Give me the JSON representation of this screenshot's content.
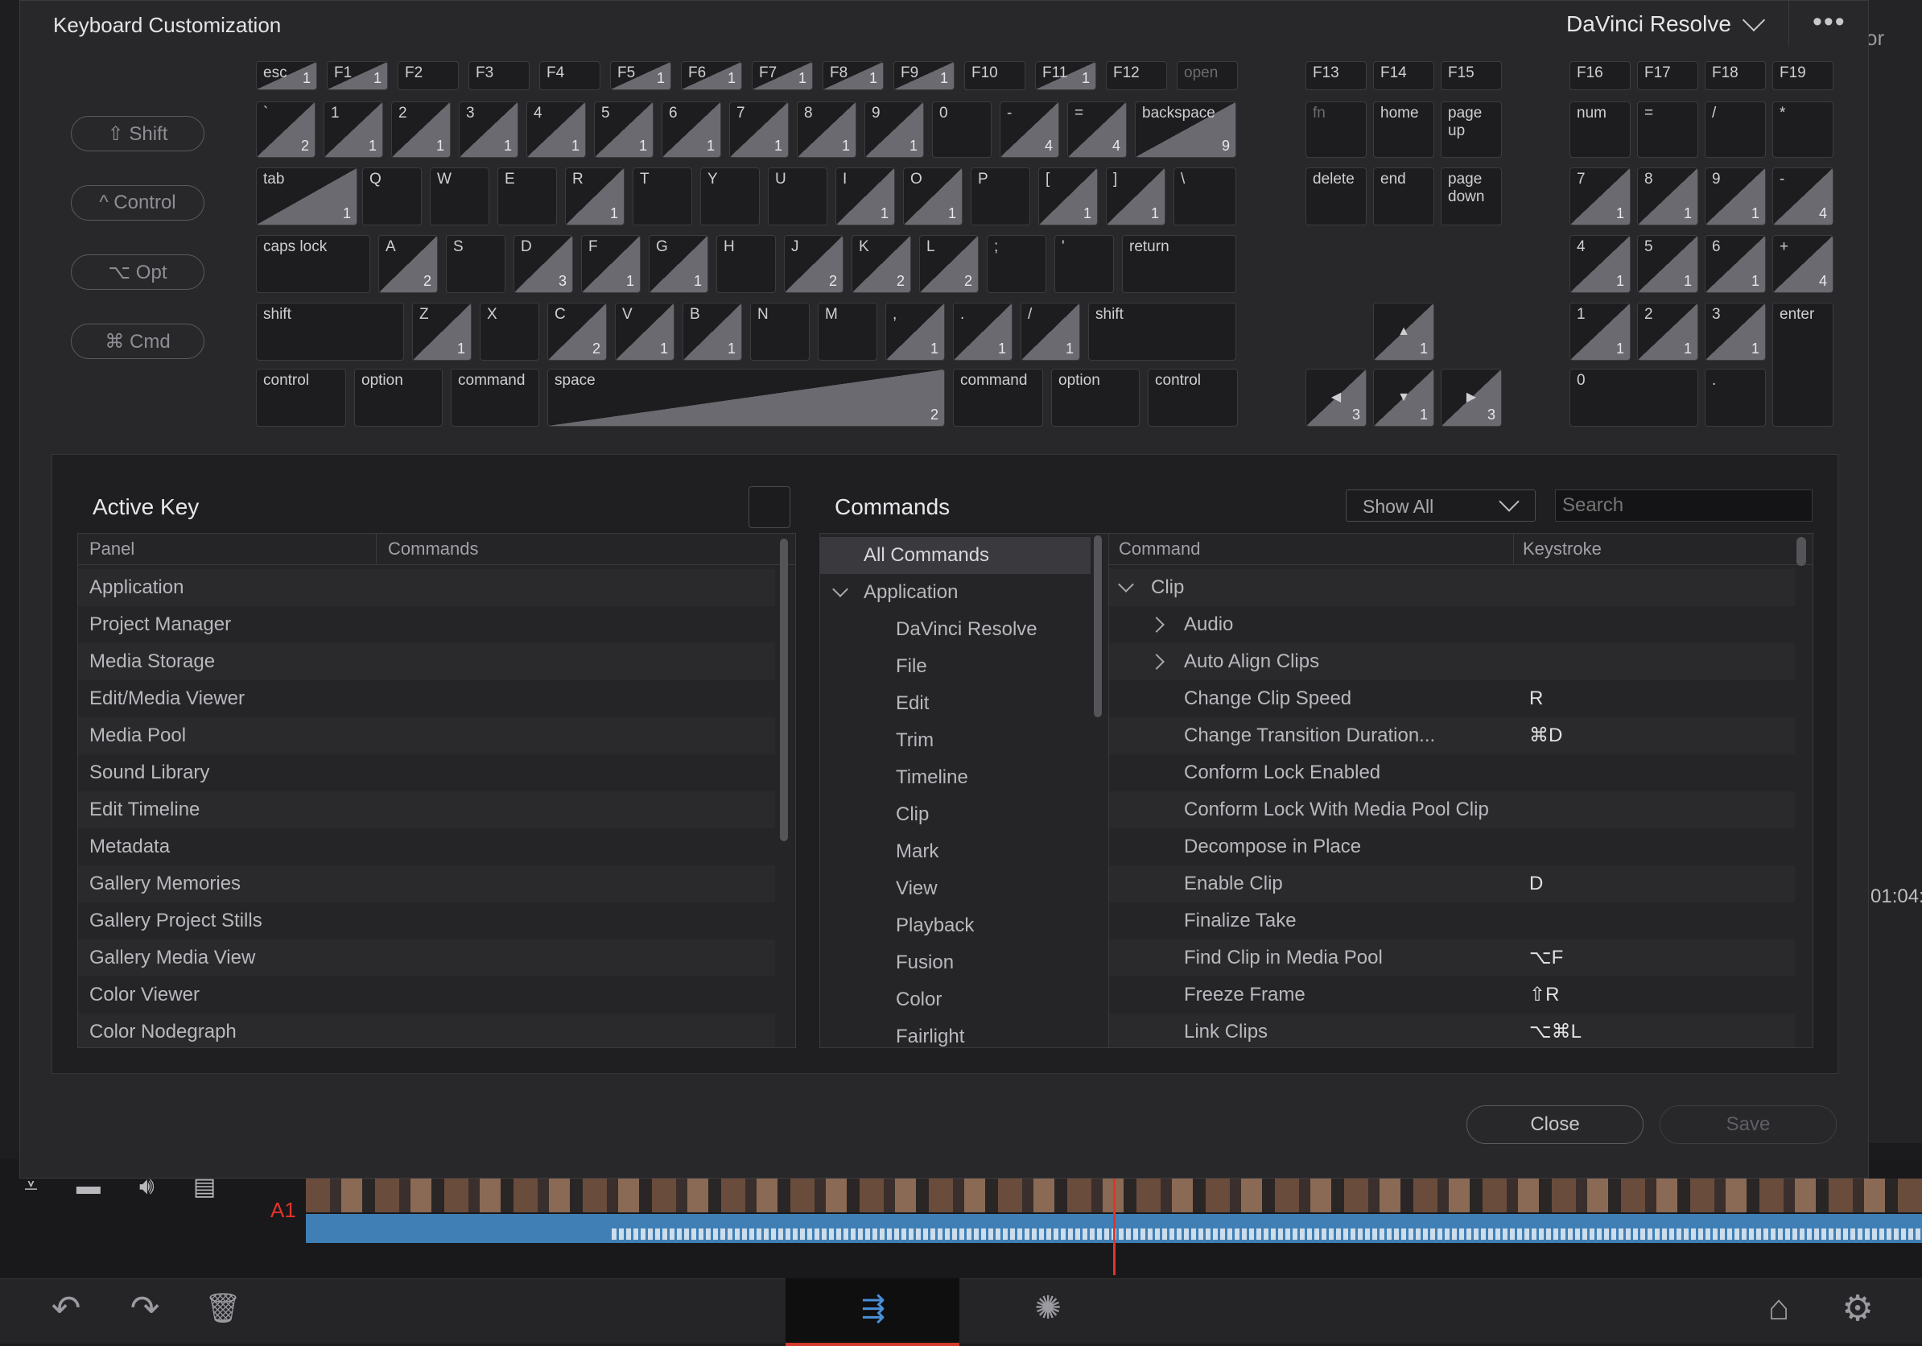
{
  "background_app": {
    "right_edge_text": "or",
    "timecode": "01:04:",
    "track_label": "A1",
    "accent_color": "#e0342b"
  },
  "dialog": {
    "title": "Keyboard Customization",
    "preset": "DaVinci Resolve",
    "more_icon": "ellipsis-icon"
  },
  "modifiers": [
    "⇧ Shift",
    "^ Control",
    "⌥ Opt",
    "⌘ Cmd"
  ],
  "keyboard": {
    "rows": [
      [
        {
          "l": "esc",
          "c": "1"
        },
        {
          "l": "F1",
          "c": "1"
        },
        {
          "l": "F2"
        },
        {
          "l": "F3"
        },
        {
          "l": "F4"
        },
        {
          "l": "F5",
          "c": "1"
        },
        {
          "l": "F6",
          "c": "1"
        },
        {
          "l": "F7",
          "c": "1"
        },
        {
          "l": "F8",
          "c": "1"
        },
        {
          "l": "F9",
          "c": "1"
        },
        {
          "l": "F10"
        },
        {
          "l": "F11",
          "c": "1"
        },
        {
          "l": "F12"
        },
        {
          "l": "open",
          "dim": true
        }
      ],
      [
        {
          "l": "`",
          "c": "2"
        },
        {
          "l": "1",
          "c": "1"
        },
        {
          "l": "2",
          "c": "1"
        },
        {
          "l": "3",
          "c": "1"
        },
        {
          "l": "4",
          "c": "1"
        },
        {
          "l": "5",
          "c": "1"
        },
        {
          "l": "6",
          "c": "1"
        },
        {
          "l": "7",
          "c": "1"
        },
        {
          "l": "8",
          "c": "1"
        },
        {
          "l": "9",
          "c": "1"
        },
        {
          "l": "0"
        },
        {
          "l": "-",
          "c": "4"
        },
        {
          "l": "=",
          "c": "4"
        },
        {
          "l": "backspace",
          "c": "9"
        }
      ],
      [
        {
          "l": "tab",
          "c": "1"
        },
        {
          "l": "Q"
        },
        {
          "l": "W"
        },
        {
          "l": "E"
        },
        {
          "l": "R",
          "c": "1"
        },
        {
          "l": "T"
        },
        {
          "l": "Y"
        },
        {
          "l": "U"
        },
        {
          "l": "I",
          "c": "1"
        },
        {
          "l": "O",
          "c": "1"
        },
        {
          "l": "P"
        },
        {
          "l": "[",
          "c": "1"
        },
        {
          "l": "]",
          "c": "1"
        },
        {
          "l": "\\"
        }
      ],
      [
        {
          "l": "caps lock"
        },
        {
          "l": "A",
          "c": "2"
        },
        {
          "l": "S"
        },
        {
          "l": "D",
          "c": "3"
        },
        {
          "l": "F",
          "c": "1"
        },
        {
          "l": "G",
          "c": "1"
        },
        {
          "l": "H"
        },
        {
          "l": "J",
          "c": "2"
        },
        {
          "l": "K",
          "c": "2"
        },
        {
          "l": "L",
          "c": "2"
        },
        {
          "l": ";"
        },
        {
          "l": "'"
        },
        {
          "l": "return"
        }
      ],
      [
        {
          "l": "shift"
        },
        {
          "l": "Z",
          "c": "1"
        },
        {
          "l": "X"
        },
        {
          "l": "C",
          "c": "2"
        },
        {
          "l": "V",
          "c": "1"
        },
        {
          "l": "B",
          "c": "1"
        },
        {
          "l": "N"
        },
        {
          "l": "M"
        },
        {
          "l": ",",
          "c": "1"
        },
        {
          "l": ".",
          "c": "1"
        },
        {
          "l": "/",
          "c": "1"
        },
        {
          "l": "shift"
        }
      ],
      [
        {
          "l": "control"
        },
        {
          "l": "option"
        },
        {
          "l": "command"
        },
        {
          "l": "space",
          "c": "2"
        },
        {
          "l": "command"
        },
        {
          "l": "option"
        },
        {
          "l": "control"
        }
      ]
    ],
    "nav": [
      {
        "l": "F13"
      },
      {
        "l": "F14"
      },
      {
        "l": "F15"
      },
      {
        "l": "fn",
        "dim": true
      },
      {
        "l": "home"
      },
      {
        "l": "page\nup"
      },
      {
        "l": "delete"
      },
      {
        "l": "end"
      },
      {
        "l": "page\ndown"
      },
      {
        "l": "▲",
        "c": "1"
      },
      {
        "l": "◀",
        "c": "3"
      },
      {
        "l": "▼",
        "c": "1"
      },
      {
        "l": "▶",
        "c": "3"
      }
    ],
    "numpad": [
      {
        "l": "F16"
      },
      {
        "l": "F17"
      },
      {
        "l": "F18"
      },
      {
        "l": "F19"
      },
      {
        "l": "num"
      },
      {
        "l": "="
      },
      {
        "l": "/"
      },
      {
        "l": "*"
      },
      {
        "l": "7",
        "c": "1"
      },
      {
        "l": "8",
        "c": "1"
      },
      {
        "l": "9",
        "c": "1"
      },
      {
        "l": "-",
        "c": "4"
      },
      {
        "l": "4",
        "c": "1"
      },
      {
        "l": "5",
        "c": "1"
      },
      {
        "l": "6",
        "c": "1"
      },
      {
        "l": "+",
        "c": "4"
      },
      {
        "l": "1",
        "c": "1"
      },
      {
        "l": "2",
        "c": "1"
      },
      {
        "l": "3",
        "c": "1"
      },
      {
        "l": "enter"
      },
      {
        "l": "0"
      },
      {
        "l": "."
      }
    ]
  },
  "active_key": {
    "title": "Active Key",
    "columns": [
      "Panel",
      "Commands"
    ],
    "panels": [
      "Application",
      "Project Manager",
      "Media Storage",
      "Edit/Media Viewer",
      "Media Pool",
      "Sound Library",
      "Edit Timeline",
      "Metadata",
      "Gallery Memories",
      "Gallery Project Stills",
      "Gallery Media View",
      "Color Viewer",
      "Color Nodegraph"
    ]
  },
  "commands": {
    "title": "Commands",
    "filter": "Show All",
    "search_placeholder": "Search",
    "tree": [
      {
        "label": "All Commands",
        "level": 0,
        "selected": true
      },
      {
        "label": "Application",
        "level": 0,
        "expanded": true
      },
      {
        "label": "DaVinci Resolve",
        "level": 1
      },
      {
        "label": "File",
        "level": 1
      },
      {
        "label": "Edit",
        "level": 1
      },
      {
        "label": "Trim",
        "level": 1
      },
      {
        "label": "Timeline",
        "level": 1
      },
      {
        "label": "Clip",
        "level": 1
      },
      {
        "label": "Mark",
        "level": 1
      },
      {
        "label": "View",
        "level": 1
      },
      {
        "label": "Playback",
        "level": 1
      },
      {
        "label": "Fusion",
        "level": 1
      },
      {
        "label": "Color",
        "level": 1
      },
      {
        "label": "Fairlight",
        "level": 1
      }
    ],
    "columns": [
      "Command",
      "Keystroke"
    ],
    "list": [
      {
        "cmd": "Clip",
        "key": "",
        "level": 0,
        "expander": "down"
      },
      {
        "cmd": "Audio",
        "key": "",
        "level": 1,
        "expander": "right"
      },
      {
        "cmd": "Auto Align Clips",
        "key": "",
        "level": 1,
        "expander": "right"
      },
      {
        "cmd": "Change Clip Speed",
        "key": "R",
        "level": 1
      },
      {
        "cmd": "Change Transition Duration...",
        "key": "⌘D",
        "level": 1
      },
      {
        "cmd": "Conform Lock Enabled",
        "key": "",
        "level": 1
      },
      {
        "cmd": "Conform Lock With Media Pool Clip",
        "key": "",
        "level": 1
      },
      {
        "cmd": "Decompose in Place",
        "key": "",
        "level": 1
      },
      {
        "cmd": "Enable Clip",
        "key": "D",
        "level": 1
      },
      {
        "cmd": "Finalize Take",
        "key": "",
        "level": 1
      },
      {
        "cmd": "Find Clip in Media Pool",
        "key": "⌥F",
        "level": 1
      },
      {
        "cmd": "Freeze Frame",
        "key": "⇧R",
        "level": 1
      },
      {
        "cmd": "Link Clips",
        "key": "⌥⌘L",
        "level": 1
      }
    ]
  },
  "buttons": {
    "close": "Close",
    "save": "Save"
  },
  "bottom_bar": {
    "undo_icon": "undo-icon",
    "redo_icon": "redo-icon",
    "trash_icon": "trash-icon",
    "cut_icon": "cut-page-icon",
    "fx_icon": "effects-icon",
    "home_icon": "home-icon",
    "settings_icon": "gear-icon"
  }
}
